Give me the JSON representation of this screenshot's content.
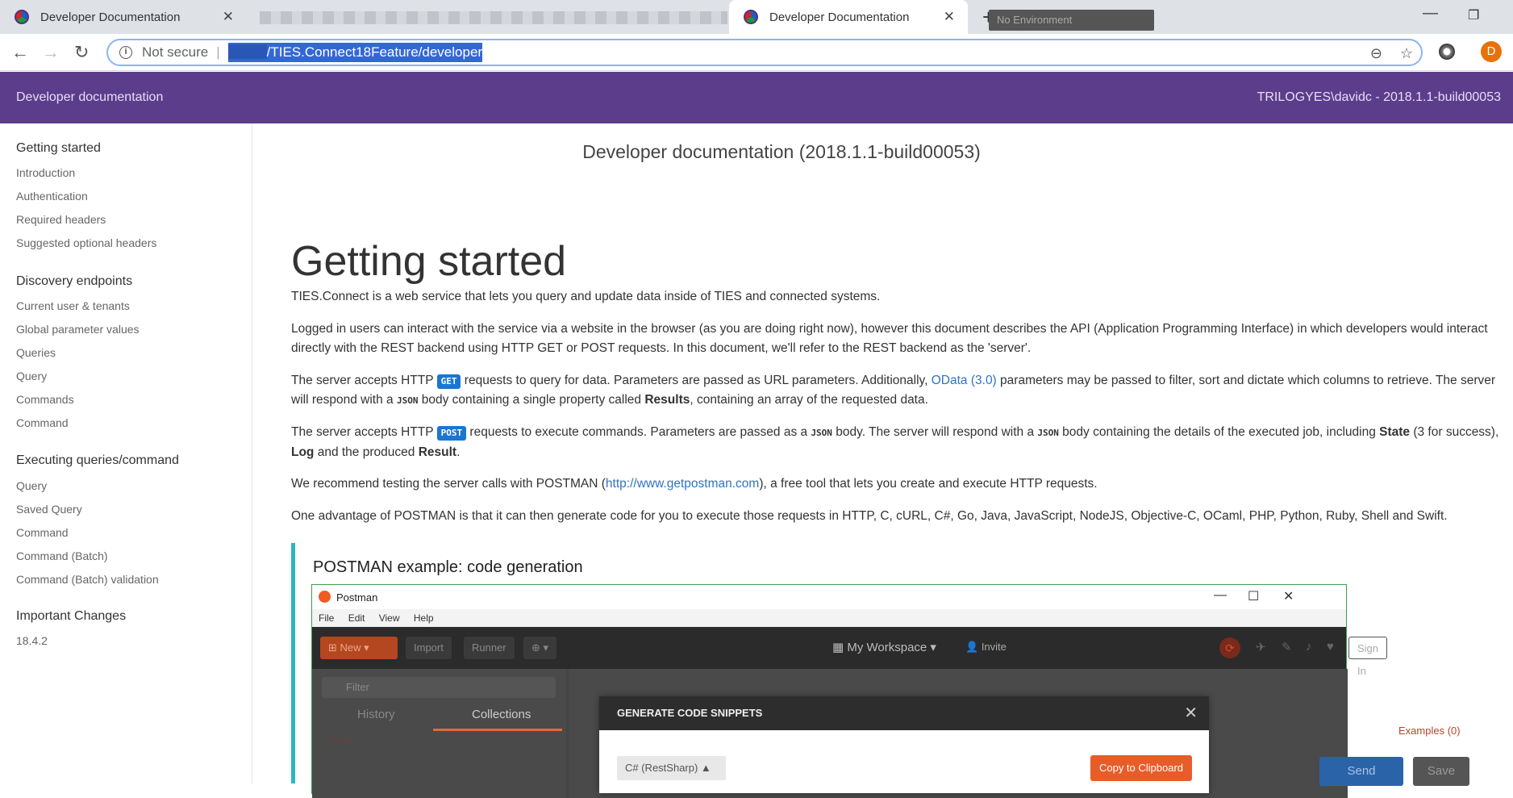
{
  "browser": {
    "tabs": [
      {
        "title": "Developer Documentation"
      },
      {
        "title": "Developer Documentation"
      }
    ],
    "url_prefix": "Not secure",
    "url_path": "/TIES.Connect18Feature/developer"
  },
  "header": {
    "title": "Developer documentation",
    "user": "TRILOGYES\\davidc - 2018.1.1-build00053"
  },
  "sidebar": {
    "sections": [
      {
        "title": "Getting started",
        "items": [
          "Introduction",
          "Authentication",
          "Required headers",
          "Suggested optional headers"
        ]
      },
      {
        "title": "Discovery endpoints",
        "items": [
          "Current user & tenants",
          "Global parameter values",
          "Queries",
          "Query",
          "Commands",
          "Command"
        ]
      },
      {
        "title": "Executing queries/command",
        "items": [
          "Query",
          "Saved Query",
          "Command",
          "Command (Batch)",
          "Command (Batch) validation"
        ]
      },
      {
        "title": "Important Changes",
        "items": [
          "18.4.2"
        ]
      }
    ]
  },
  "main": {
    "doc_title": "Developer documentation (2018.1.1-build00053)",
    "heading": "Getting started",
    "p1": "TIES.Connect is a web service that lets you query and update data inside of TIES and connected systems.",
    "p2": "Logged in users can interact with the service via a website in the browser (as you are doing right now), however this document describes the API (Application Programming Interface) in which developers would interact directly with the REST backend using HTTP GET or POST requests. In this document, we'll refer to the REST backend as the 'server'.",
    "p3": {
      "a": "The server accepts HTTP ",
      "get": "GET",
      "b": " requests to query for data. Parameters are passed as URL parameters. Additionally, ",
      "odata": "OData (3.0)",
      "c": " parameters may be passed to filter, sort and dictate which columns to retrieve. The server will respond with a ",
      "json": "JSON",
      "d": " body containing a single property called ",
      "results": "Results",
      "e": ", containing an array of the requested data."
    },
    "p4": {
      "a": "The server accepts HTTP ",
      "post": "POST",
      "b": " requests to execute commands. Parameters are passed as a ",
      "json1": "JSON",
      "c": " body. The server will respond with a ",
      "json2": "JSON",
      "d": " body containing the details of the executed job, including ",
      "state": "State",
      "e": " (3 for success), ",
      "log": "Log",
      "f": " and the produced ",
      "result": "Result",
      "g": "."
    },
    "p5": {
      "a": "We recommend testing the server calls with POSTMAN (",
      "link": "http://www.getpostman.com",
      "b": "), a free tool that lets you create and execute HTTP requests."
    },
    "p6": "One advantage of POSTMAN is that it can then generate code for you to execute those requests in HTTP, C, cURL, C#, Go, Java, JavaScript, NodeJS, Objective-C, OCaml, PHP, Python, Ruby, Shell and Swift.",
    "example_title": "POSTMAN example: code generation"
  },
  "postman": {
    "app_name": "Postman",
    "menu": [
      "File",
      "Edit",
      "View",
      "Help"
    ],
    "toolbar": {
      "new": "New",
      "import": "Import",
      "runner": "Runner",
      "workspace": "My Workspace",
      "invite": "Invite",
      "signin": "Sign In"
    },
    "filter_placeholder": "Filter",
    "tabs": [
      "History",
      "Collections"
    ],
    "trash": "Trash",
    "environment": "No Environment",
    "examples": "Examples (0)",
    "send": "Send",
    "save": "Save",
    "modal": {
      "title": "GENERATE CODE SNIPPETS",
      "language": "C# (RestSharp)",
      "copy": "Copy to Clipboard"
    }
  }
}
